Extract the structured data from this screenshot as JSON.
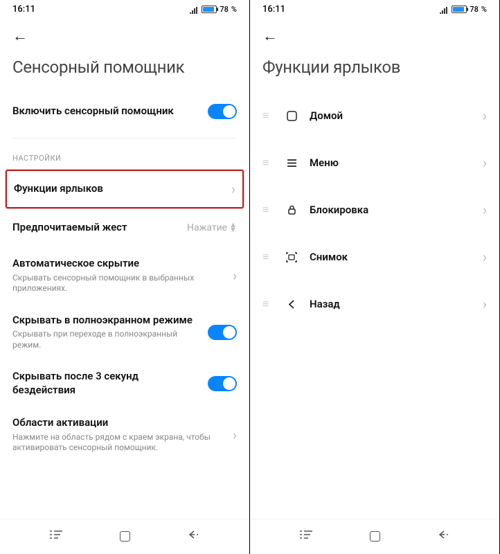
{
  "status": {
    "time": "16:11",
    "battery_pct": "78",
    "battery_suffix": "%"
  },
  "screen1": {
    "title": "Сенсорный помощник",
    "enable": {
      "label": "Включить сенсорный помощник"
    },
    "section": "НАСТРОЙКИ",
    "shortcuts": {
      "label": "Функции ярлыков"
    },
    "gesture": {
      "label": "Предпочитаемый жест",
      "value": "Нажатие"
    },
    "autohide": {
      "label": "Автоматическое скрытие",
      "sub": "Скрывать сенсорный помощник в выбранных приложениях."
    },
    "fullscreen": {
      "label": "Скрывать в полноэкранном режиме",
      "sub": "Скрывать при переходе в полноэкранный режим."
    },
    "idle": {
      "label": "Скрывать после 3 секунд бездействия"
    },
    "areas": {
      "label": "Области активации",
      "sub": "Нажмите на область рядом с краем экрана, чтобы активировать сенсорный помощник."
    }
  },
  "screen2": {
    "title": "Функции ярлыков",
    "items": [
      {
        "icon": "home",
        "label": "Домой"
      },
      {
        "icon": "menu",
        "label": "Меню"
      },
      {
        "icon": "lock",
        "label": "Блокировка"
      },
      {
        "icon": "screenshot",
        "label": "Снимок"
      },
      {
        "icon": "back",
        "label": "Назад"
      }
    ]
  }
}
